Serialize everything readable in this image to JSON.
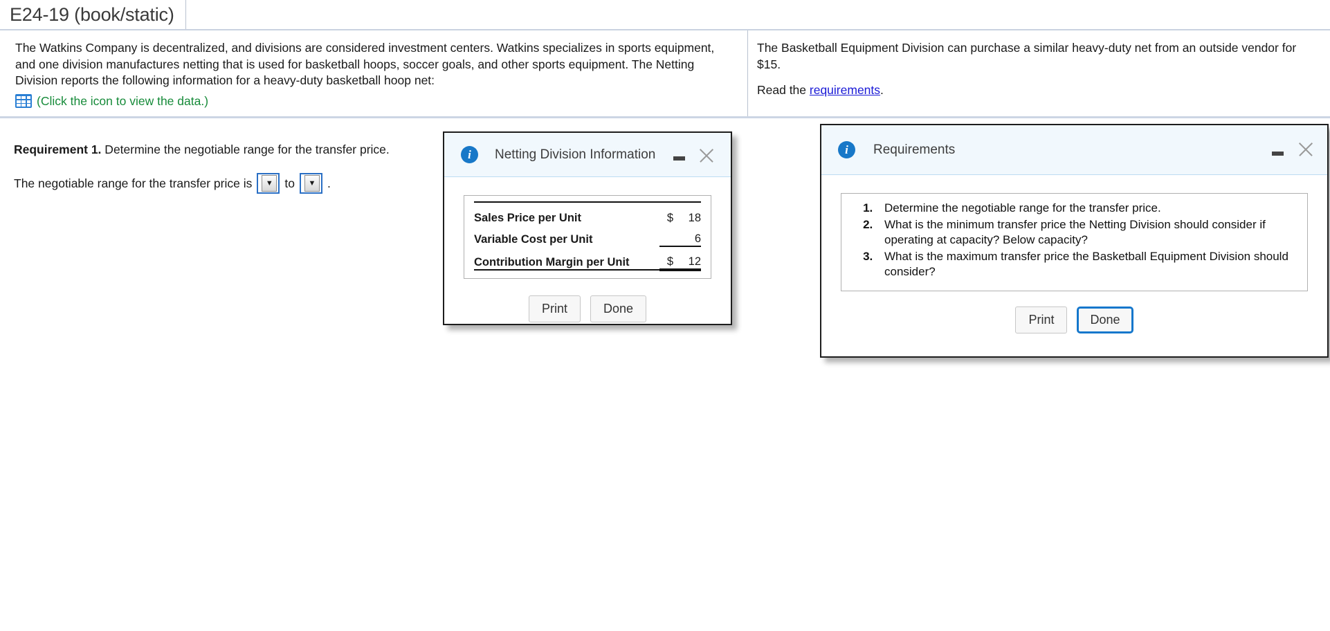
{
  "tab": {
    "title": "E24-19 (book/static)"
  },
  "problem": {
    "left_paragraph": "The Watkins Company is decentralized, and divisions are considered investment centers. Watkins specializes in sports equipment, and one division manufactures netting that is used for basketball hoops, soccer goals, and other sports equipment. The Netting Division reports the following information for a heavy-duty basketball hoop net:",
    "data_icon_name": "grid-table-icon",
    "data_link": "(Click the icon to view the data.)",
    "right_paragraph": "The Basketball Equipment Division can purchase a similar heavy-duty net from an outside vendor for $15.",
    "read_prefix": "Read the ",
    "read_link": "requirements",
    "read_suffix": "."
  },
  "requirement1": {
    "label": "Requirement 1.",
    "prompt": " Determine the negotiable range for the transfer price.",
    "answer_prefix": "The negotiable range for the transfer price is",
    "dropdown_low_value": "",
    "dropdown_separator": "to",
    "dropdown_high_value": "",
    "answer_suffix": ".",
    "caret_glyph": "▼"
  },
  "netting_dialog": {
    "title": "Netting Division Information",
    "info_glyph": "i",
    "minimize_name": "minimize-icon",
    "close_name": "close-icon",
    "table": {
      "rows": [
        {
          "label": "Sales Price per Unit",
          "currency": "$",
          "value": "18"
        },
        {
          "label": "Variable Cost per Unit",
          "currency": "",
          "value": "6"
        },
        {
          "label": "Contribution Margin per Unit",
          "currency": "$",
          "value": "12"
        }
      ]
    },
    "print_label": "Print",
    "done_label": "Done"
  },
  "requirements_dialog": {
    "title": "Requirements",
    "info_glyph": "i",
    "items": [
      "Determine the negotiable range for the transfer price.",
      "What is the minimum transfer price the Netting Division should consider if operating at capacity? Below capacity?",
      "What is the maximum transfer price the Basketball Equipment Division should consider?"
    ],
    "print_label": "Print",
    "done_label": "Done"
  },
  "colors": {
    "accent_blue": "#1878c8",
    "link_green": "#178b3a",
    "link_blue": "#1a1ad6",
    "focus_blue": "#1477cc",
    "dialog_header": "#f1f8fd"
  }
}
